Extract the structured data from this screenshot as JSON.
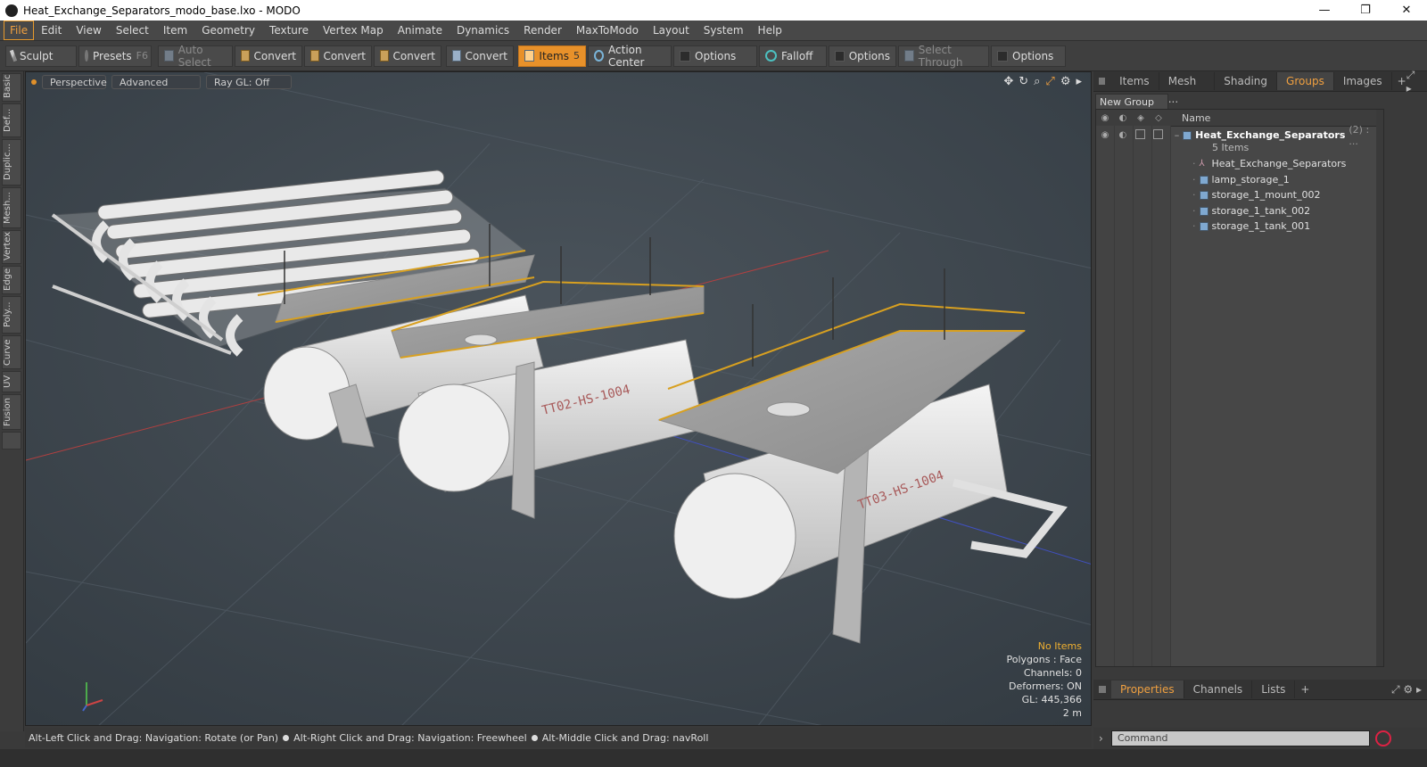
{
  "window": {
    "title": "Heat_Exchange_Separators_modo_base.lxo - MODO",
    "minimize": "—",
    "restore": "❐",
    "close": "✕"
  },
  "menu": [
    "File",
    "Edit",
    "View",
    "Select",
    "Item",
    "Geometry",
    "Texture",
    "Vertex Map",
    "Animate",
    "Dynamics",
    "Render",
    "MaxToModo",
    "Layout",
    "System",
    "Help"
  ],
  "toolbar": {
    "sculpt": "Sculpt",
    "presets": "Presets",
    "presets_key": "F6",
    "auto_select": "Auto Select",
    "convert1": "Convert",
    "convert2": "Convert",
    "convert3": "Convert",
    "convert4": "Convert",
    "items": "Items",
    "items_key": "5",
    "action_center": "Action Center",
    "options1": "Options",
    "falloff": "Falloff",
    "options2": "Options",
    "select_through": "Select Through",
    "options3": "Options"
  },
  "left_tabs": [
    "Basic",
    "Def...",
    "Duplic...",
    "Mesh...",
    "Vertex",
    "Edge",
    "Poly...",
    "Curve",
    "UV",
    "Fusion"
  ],
  "viewport": {
    "view": "Perspective",
    "shading": "Advanced",
    "raygl": "Ray GL: Off",
    "info": {
      "items": "No Items",
      "polygons": "Polygons : Face",
      "channels": "Channels: 0",
      "deformers": "Deformers: ON",
      "gl": "GL: 445,366",
      "scale": "2 m"
    },
    "labels": {
      "tank1": "TT02-HS-1004",
      "tank2": "TT03-HS-1004"
    }
  },
  "status": {
    "hint1": "Alt-Left Click and Drag: Navigation: Rotate (or Pan)",
    "hint2": "Alt-Right Click and Drag: Navigation: Freewheel",
    "hint3": "Alt-Middle Click and Drag: navRoll"
  },
  "right_panel": {
    "tabs": [
      "Items",
      "Mesh ...",
      "Shading",
      "Groups",
      "Images"
    ],
    "active_tab": "Groups",
    "new_group": "New Group",
    "name_header": "Name",
    "group": {
      "name": "Heat_Exchange_Separators",
      "count": "(2) : ...",
      "items": "5 Items"
    },
    "children": [
      "Heat_Exchange_Separators",
      "lamp_storage_1",
      "storage_1_mount_002",
      "storage_1_tank_002",
      "storage_1_tank_001"
    ]
  },
  "properties": {
    "tabs": [
      "Properties",
      "Channels",
      "Lists"
    ],
    "active_tab": "Properties"
  },
  "command": {
    "placeholder": "Command"
  }
}
